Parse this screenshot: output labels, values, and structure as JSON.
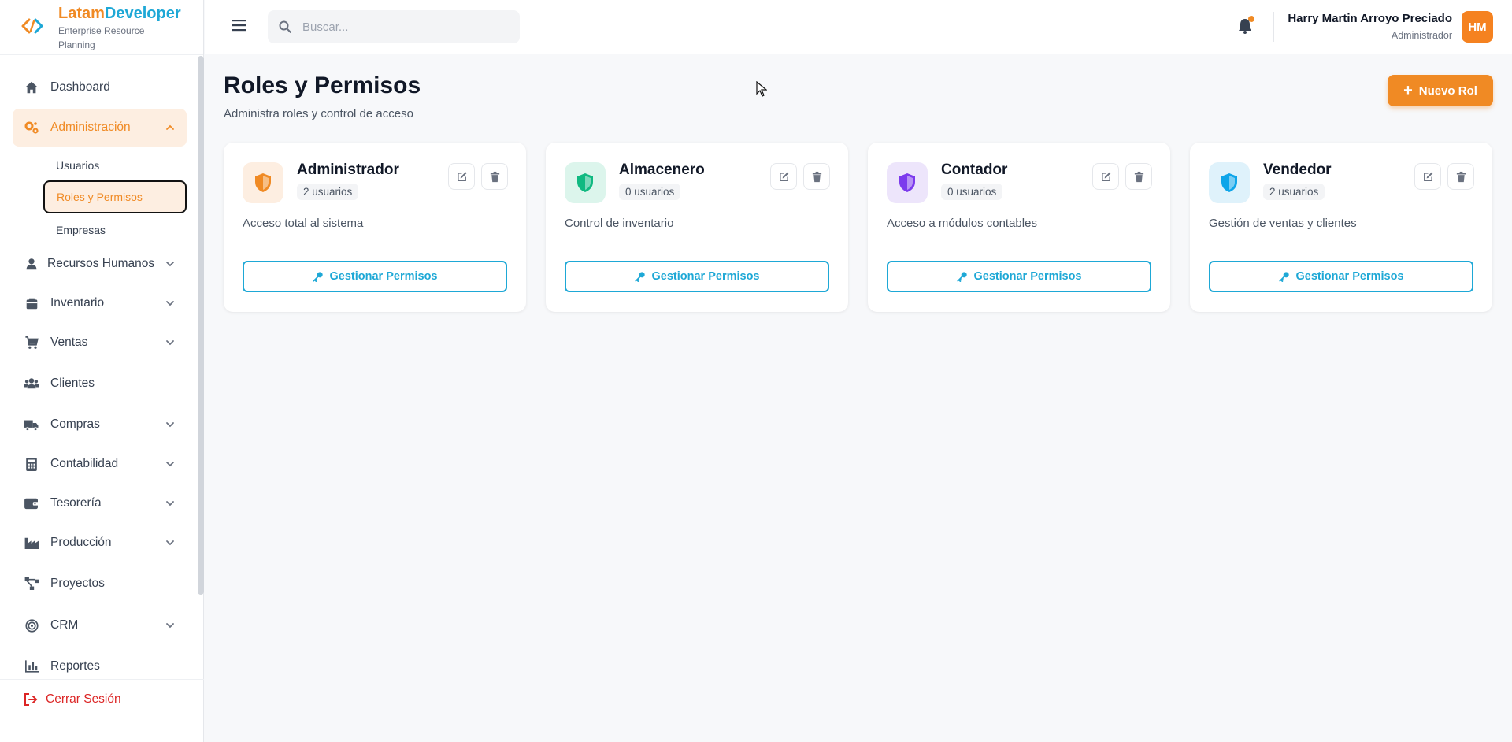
{
  "brand": {
    "name_part1": "Latam",
    "name_part2": "Developer",
    "subtitle": "Enterprise Resource Planning"
  },
  "sidebar": {
    "items": [
      {
        "label": "Dashboard",
        "icon": "home-icon"
      },
      {
        "label": "Administración",
        "icon": "cogs-icon",
        "expanded": true
      },
      {
        "label": "Recursos Humanos",
        "icon": "user-tie-icon"
      },
      {
        "label": "Inventario",
        "icon": "boxes-icon"
      },
      {
        "label": "Ventas",
        "icon": "cart-icon"
      },
      {
        "label": "Clientes",
        "icon": "users-icon"
      },
      {
        "label": "Compras",
        "icon": "truck-icon"
      },
      {
        "label": "Contabilidad",
        "icon": "calculator-icon"
      },
      {
        "label": "Tesorería",
        "icon": "wallet-icon"
      },
      {
        "label": "Producción",
        "icon": "industry-icon"
      },
      {
        "label": "Proyectos",
        "icon": "project-diagram-icon"
      },
      {
        "label": "CRM",
        "icon": "bullseye-icon"
      },
      {
        "label": "Reportes",
        "icon": "chart-icon"
      }
    ],
    "admin_sub": [
      {
        "label": "Usuarios"
      },
      {
        "label": "Roles y Permisos",
        "current": true
      },
      {
        "label": "Empresas"
      }
    ],
    "logout_label": "Cerrar Sesión"
  },
  "header": {
    "search_placeholder": "Buscar...",
    "user_name": "Harry Martin Arroyo Preciado",
    "user_role": "Administrador",
    "avatar_initials": "HM"
  },
  "page": {
    "title": "Roles y Permisos",
    "subtitle": "Administra roles y control de acceso",
    "new_button": "Nuevo Rol"
  },
  "roles": [
    {
      "name": "Administrador",
      "users": "2 usuarios",
      "description": "Acceso total al sistema",
      "color": "#f08a24",
      "bg": "#fdeee1"
    },
    {
      "name": "Almacenero",
      "users": "0 usuarios",
      "description": "Control de inventario",
      "color": "#10b981",
      "bg": "#dcf5ec"
    },
    {
      "name": "Contador",
      "users": "0 usuarios",
      "description": "Acceso a módulos contables",
      "color": "#7c3aed",
      "bg": "#ede5fb"
    },
    {
      "name": "Vendedor",
      "users": "2 usuarios",
      "description": "Gestión de ventas y clientes",
      "color": "#0ea5e9",
      "bg": "#dff2fb"
    }
  ],
  "card_button": "Gestionar Permisos",
  "colors": {
    "accent": "#f08a24",
    "secondary": "#1ea8d6",
    "danger": "#dc2626"
  }
}
